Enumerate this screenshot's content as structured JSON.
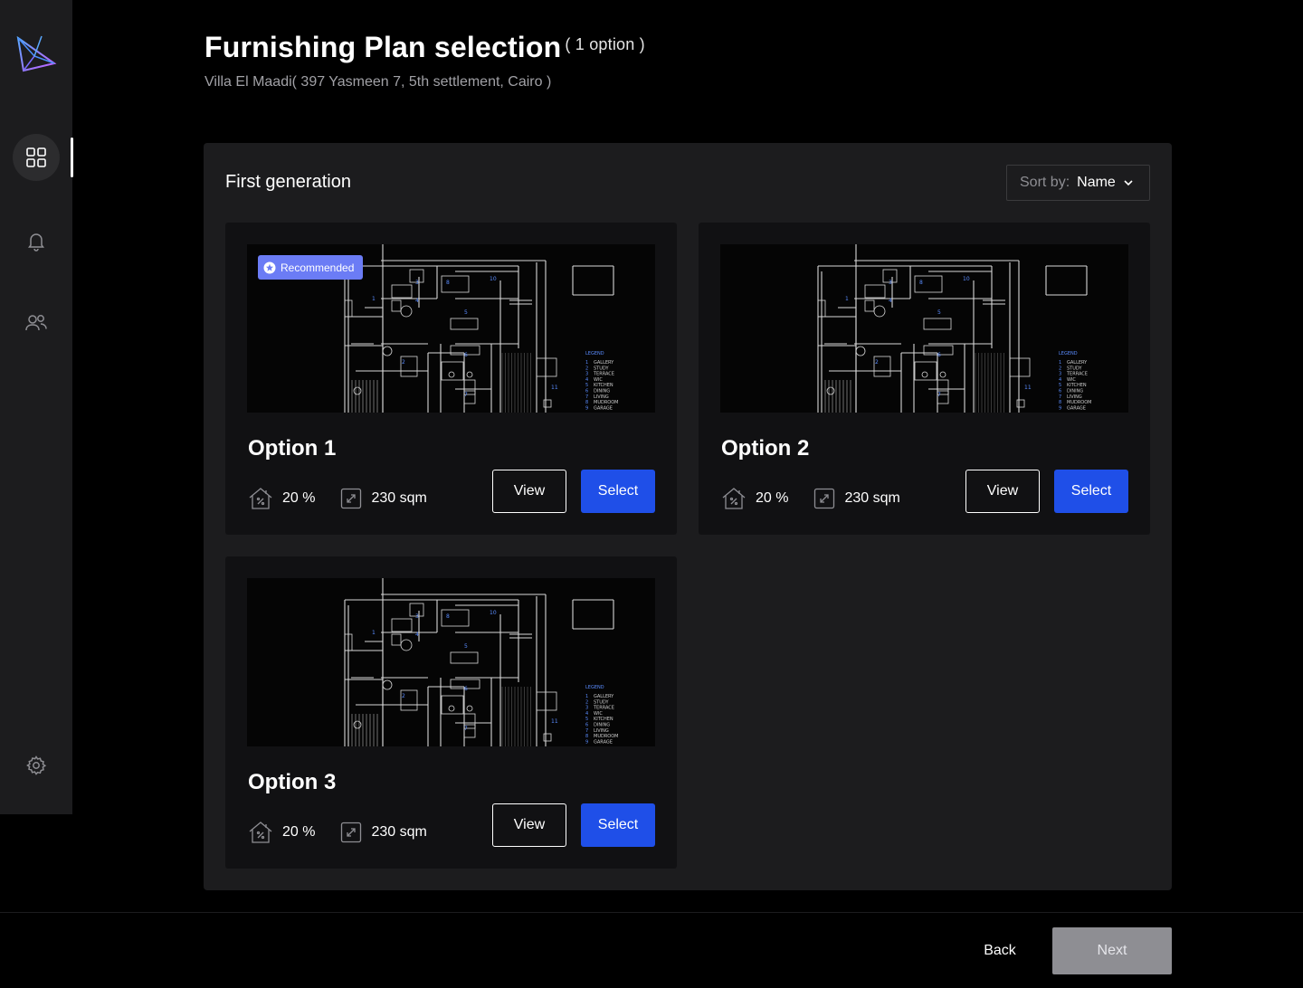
{
  "header": {
    "title": "Furnishing Plan selection",
    "count": "( 1 option )",
    "subtitle": "Villa El Maadi( 397 Yasmeen 7, 5th settlement, Cairo )"
  },
  "sidebar": {
    "items": [
      {
        "icon": "grid-icon",
        "active": true
      },
      {
        "icon": "bell-icon",
        "active": false
      },
      {
        "icon": "users-icon",
        "active": false
      },
      {
        "icon": "gear-icon",
        "active": false
      }
    ]
  },
  "panel": {
    "title": "First generation",
    "sort_label": "Sort by:",
    "sort_value": "Name"
  },
  "options": [
    {
      "title": "Option 1",
      "ratio": "20 %",
      "area": "230 sqm",
      "view": "View",
      "select": "Select",
      "badge": "Recommended"
    },
    {
      "title": "Option 2",
      "ratio": "20 %",
      "area": "230 sqm",
      "view": "View",
      "select": "Select"
    },
    {
      "title": "Option 3",
      "ratio": "20 %",
      "area": "230 sqm",
      "view": "View",
      "select": "Select"
    }
  ],
  "floorplan_legend": {
    "heading": "LEGEND",
    "rooms": [
      "GALLERY",
      "STUDY",
      "TERRACE",
      "WIC",
      "KITCHEN",
      "DINING",
      "LIVING",
      "MUDROOM",
      "GARAGE"
    ]
  },
  "footer": {
    "back": "Back",
    "next": "Next"
  },
  "colors": {
    "accent": "#1f4fe8",
    "badge": "#6b7cf5",
    "panel": "#1c1c1e",
    "card": "#111113",
    "disabled": "#8e8e93"
  }
}
